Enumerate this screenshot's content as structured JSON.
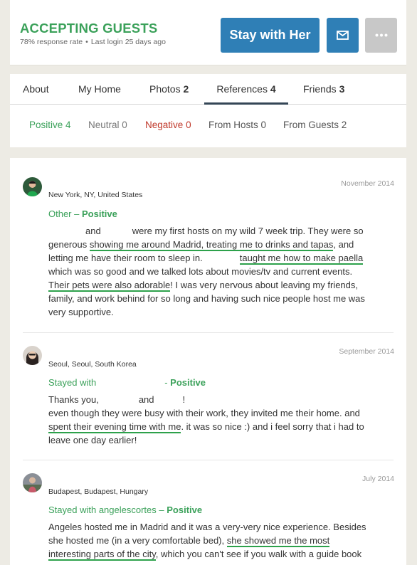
{
  "header": {
    "status": "ACCEPTING GUESTS",
    "response_rate": "78% response rate",
    "last_login": "Last login 25 days ago",
    "stay_button": "Stay with Her",
    "message_icon": "envelope-icon",
    "more_icon": "ellipsis-icon"
  },
  "tabs": [
    {
      "label": "About",
      "count": ""
    },
    {
      "label": "My Home",
      "count": ""
    },
    {
      "label": "Photos",
      "count": "2"
    },
    {
      "label": "References",
      "count": "4"
    },
    {
      "label": "Friends",
      "count": "3"
    }
  ],
  "subtabs": [
    {
      "label": "Positive",
      "count": "4"
    },
    {
      "label": "Neutral",
      "count": "0"
    },
    {
      "label": "Negative",
      "count": "0"
    },
    {
      "label": "From Hosts",
      "count": "0"
    },
    {
      "label": "From Guests",
      "count": "2"
    }
  ],
  "references": [
    {
      "location": "New York, NY, United States",
      "date": "November 2014",
      "type": "Other",
      "rating": "Positive",
      "text_1a": "and",
      "text_1b": "were my first hosts on my wild 7 week trip. They were so",
      "text_2a": "generous ",
      "text_2hl": "showing me around Madrid, treating me to drinks and tapas",
      "text_2b": ", and",
      "text_3a": "letting me have their room to sleep in.",
      "text_3hl": "taught me how to make paella",
      "text_4": "which was so good and we talked lots about movies/tv and current events.",
      "text_5hl": "Their pets were also adorable",
      "text_5b": "! I was very nervous about leaving my friends,",
      "text_6": "family, and work behind for so long and having such nice people host me was",
      "text_7": "very supportive."
    },
    {
      "location": "Seoul, Seoul, South Korea",
      "date": "September 2014",
      "type": "Stayed with",
      "rating": "Positive",
      "text_1a": "Thanks you,",
      "text_1b": "and",
      "text_1c": "!",
      "text_2": "even though they were busy with their work, they invited me their home. and",
      "text_3hl": "spent their evening time with me",
      "text_3b": ". it was so nice :) and i feel sorry that i had to",
      "text_4": "leave one day earlier!"
    },
    {
      "location": "Budapest, Budapest, Hungary",
      "date": "July 2014",
      "type": "Stayed with angelescortes",
      "rating": "Positive",
      "text_1": "Angeles hosted me in Madrid and it was a very-very nice experience. Besides",
      "text_2a": "she hosted me (in a very comfortable bed), ",
      "text_2hl": "she showed me the most",
      "text_3hl": "interesting parts of the city",
      "text_3b": ", which you can't see if you walk with a guide book"
    }
  ],
  "colors": {
    "accent_green": "#3ba15a",
    "button_blue": "#2f7fb6",
    "negative_red": "#c0392b",
    "highlight_green": "#2da14b"
  }
}
